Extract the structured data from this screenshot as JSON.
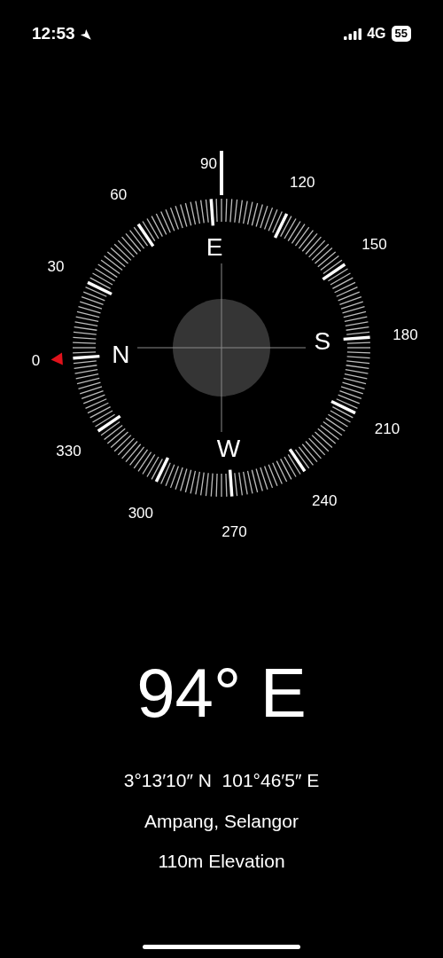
{
  "status_bar": {
    "time": "12:53",
    "network": "4G",
    "battery": "55"
  },
  "compass": {
    "cardinals": [
      "N",
      "E",
      "S",
      "W"
    ],
    "degree_labels": [
      "0",
      "30",
      "60",
      "90",
      "120",
      "150",
      "180",
      "210",
      "240",
      "270",
      "300",
      "330"
    ]
  },
  "heading": "94° E",
  "coordinates": "3°13′10″ N  101°46′5″ E",
  "place": "Ampang, Selangor",
  "elevation": "110m Elevation"
}
